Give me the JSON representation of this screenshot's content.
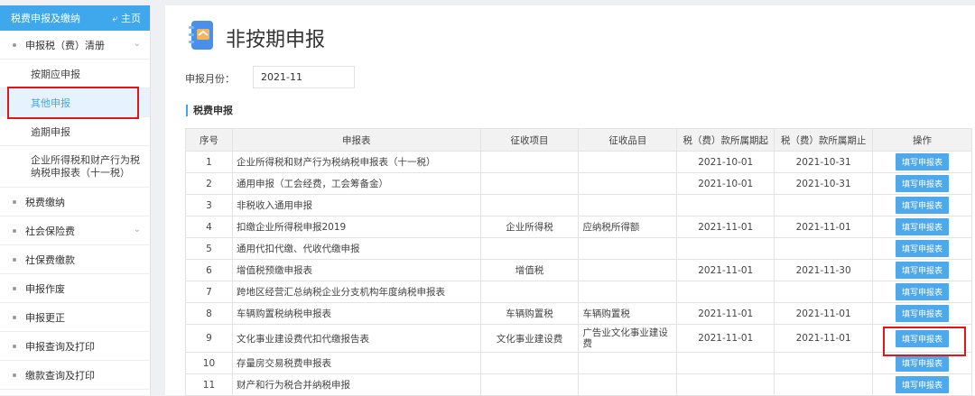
{
  "sidebar": {
    "header": "税费申报及缴纳",
    "home": "主页",
    "items": [
      {
        "label": "申报税（费）清册",
        "type": "group",
        "expand": true
      },
      {
        "label": "按期应申报",
        "type": "sub"
      },
      {
        "label": "其他申报",
        "type": "sub",
        "active": true
      },
      {
        "label": "逾期申报",
        "type": "sub"
      },
      {
        "label": "企业所得税和财产行为税纳税申报表（十一税）",
        "type": "sub2"
      },
      {
        "label": "税费缴纳",
        "type": "group"
      },
      {
        "label": "社会保险费",
        "type": "group",
        "expand": true
      },
      {
        "label": "社保费缴款",
        "type": "group"
      },
      {
        "label": "申报作废",
        "type": "group"
      },
      {
        "label": "申报更正",
        "type": "group"
      },
      {
        "label": "申报查询及打印",
        "type": "group"
      },
      {
        "label": "缴款查询及打印",
        "type": "group"
      }
    ]
  },
  "main": {
    "title": "非按期申报",
    "month_label": "申报月份：",
    "month_value": "2021-11",
    "section": "税费申报",
    "columns": [
      "序号",
      "申报表",
      "征收项目",
      "征收品目",
      "税（费）款所属期起",
      "税（费）款所属期止",
      "操作"
    ],
    "button_label": "填写申报表",
    "rows": [
      [
        "1",
        "企业所得税和财产行为税纳税申报表（十一税）",
        "",
        "",
        "2021-10-01",
        "2021-10-31"
      ],
      [
        "2",
        "通用申报（工会经费，工会筹备金）",
        "",
        "",
        "2021-10-01",
        "2021-10-31"
      ],
      [
        "3",
        "非税收入通用申报",
        "",
        "",
        "",
        ""
      ],
      [
        "4",
        "扣缴企业所得税申报2019",
        "企业所得税",
        "应纳税所得额",
        "2021-11-01",
        "2021-11-01"
      ],
      [
        "5",
        "通用代扣代缴、代收代缴申报",
        "",
        "",
        "",
        ""
      ],
      [
        "6",
        "增值税预缴申报表",
        "增值税",
        "",
        "2021-11-01",
        "2021-11-30"
      ],
      [
        "7",
        "跨地区经营汇总纳税企业分支机构年度纳税申报表",
        "",
        "",
        "",
        ""
      ],
      [
        "8",
        "车辆购置税纳税申报表",
        "车辆购置税",
        "车辆购置税",
        "2021-11-01",
        "2021-11-01"
      ],
      [
        "9",
        "文化事业建设费代扣代缴报告表",
        "文化事业建设费",
        "广告业文化事业建设费",
        "2021-11-01",
        "2021-11-01"
      ],
      [
        "10",
        "存量房交易税费申报表",
        "",
        "",
        "",
        ""
      ],
      [
        "11",
        "财产和行为税合并纳税申报",
        "",
        "",
        "",
        ""
      ]
    ]
  }
}
